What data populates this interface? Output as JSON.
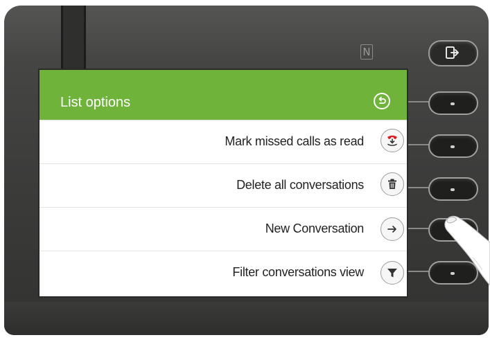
{
  "screen": {
    "header": {
      "title": "List options",
      "accent_color": "#6fb33a"
    },
    "menu": [
      {
        "label": "Mark missed calls as read",
        "icon": "missed-call-read-icon"
      },
      {
        "label": "Delete all conversations",
        "icon": "trash-icon"
      },
      {
        "label": "New Conversation",
        "icon": "arrow-right-icon"
      },
      {
        "label": "Filter conversations view",
        "icon": "filter-icon"
      }
    ]
  },
  "hardware": {
    "nfc_label": "N"
  }
}
